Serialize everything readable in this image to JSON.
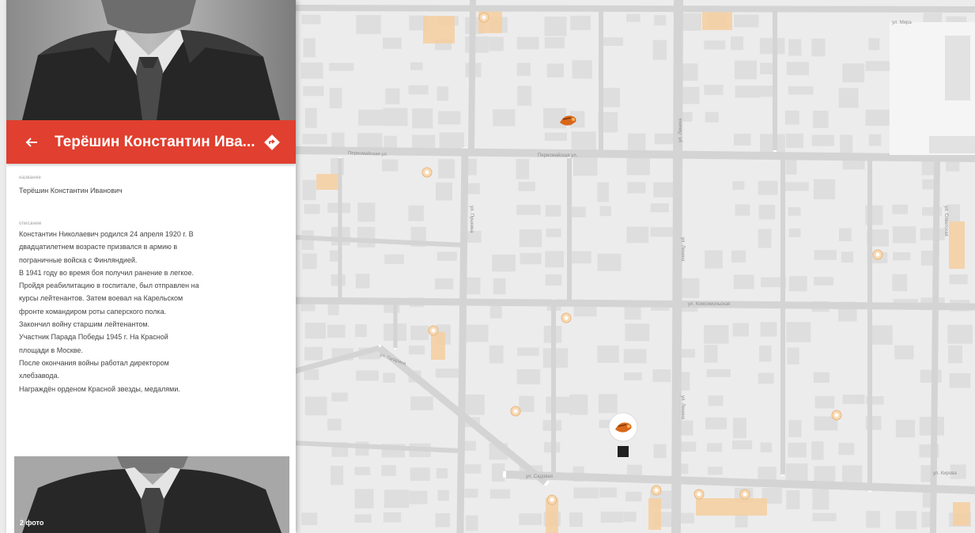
{
  "person": {
    "title": "Терёшин Константин Ива...",
    "name_label": "название",
    "name": "Терёшин Константин Иванович",
    "description_label": "описание",
    "description": [
      "Константин Николаевич родился 24 апреля 1920 г. В",
      "двадцатилетнем возрасте призвался в армию в",
      "пограничные войска с Финляндией.",
      "В 1941 году во время боя получил ранение в легкое.",
      "Пройдя реабилитацию в госпитале, был отправлен на",
      "курсы лейтенантов. Затем воевал на Карельском",
      "фронте командиром роты саперского полка.",
      "Закончил войну старшим лейтенантом.",
      "Участник Парада Победы 1945 г. На Красной",
      "площади в Москве.",
      "После окончания войны работал директором",
      "хлебзавода.",
      "Награждён орденом Красной звезды, медалями."
    ],
    "photo_count": "2 фото"
  },
  "icons": {
    "back": "arrow-left-icon",
    "route": "directions-icon",
    "marker": "military-cap-marker-icon",
    "poi": "poi-pin-icon"
  },
  "colors": {
    "header": "#e13f2f",
    "map_background": "#ececec",
    "map_building": "#dedede",
    "map_highlight": "#f6cfa0",
    "map_road": "#ffffff"
  },
  "map": {
    "street_labels": [
      "ул. Мира",
      "Первомайская ул.",
      "ул. Пушкина",
      "ул. Ленина",
      "ул. Комсомольская",
      "ул. Гагарина",
      "ул. Садовая",
      "ул. Кирова",
      "ул. Советская"
    ]
  }
}
